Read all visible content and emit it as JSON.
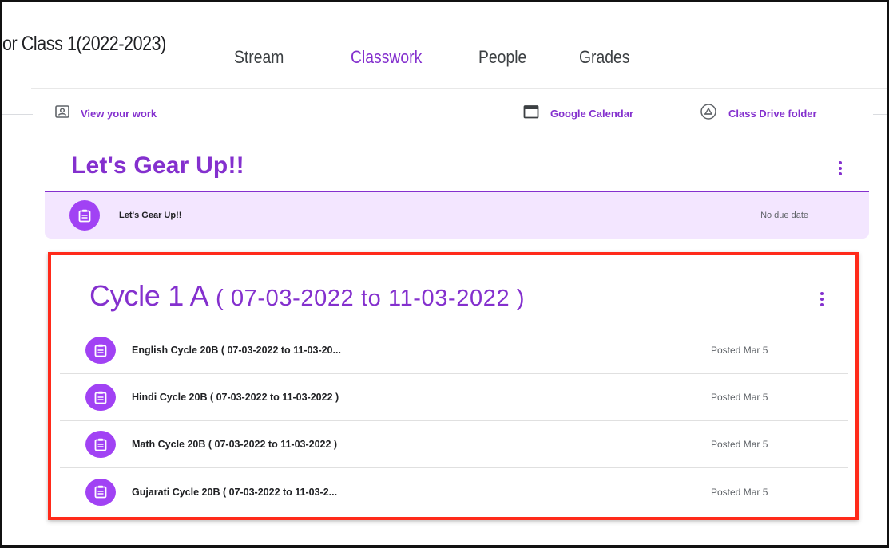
{
  "class_title": "or Class 1(2022-2023)",
  "tabs": {
    "stream": "Stream",
    "classwork": "Classwork",
    "people": "People",
    "grades": "Grades"
  },
  "actions": {
    "view_work": "View your work",
    "google_calendar": "Google Calendar",
    "class_drive_folder": "Class Drive folder"
  },
  "topic1": {
    "title": "Let's Gear Up!!",
    "item": {
      "title": "Let's Gear Up!!",
      "due": "No due date"
    }
  },
  "topic2": {
    "title_main": "Cycle 1 A",
    "title_range": " ( 07-03-2022 to 11-03-2022 )",
    "items": [
      {
        "title": "English Cycle 20B ( 07-03-2022 to 11-03-20...",
        "status": "Posted Mar 5"
      },
      {
        "title": "Hindi Cycle 20B ( 07-03-2022 to 11-03-2022 )",
        "status": "Posted Mar 5"
      },
      {
        "title": "Math Cycle 20B ( 07-03-2022 to 11-03-2022 )",
        "status": "Posted Mar 5"
      },
      {
        "title": "Gujarati Cycle 20B ( 07-03-2022 to 11-03-2...",
        "status": "Posted Mar 5"
      }
    ]
  },
  "colors": {
    "accent": "#8430ce",
    "icon_bg": "#a142f4",
    "highlight_bg": "#f3e6ff",
    "annotation_border": "#ff2a1a"
  }
}
